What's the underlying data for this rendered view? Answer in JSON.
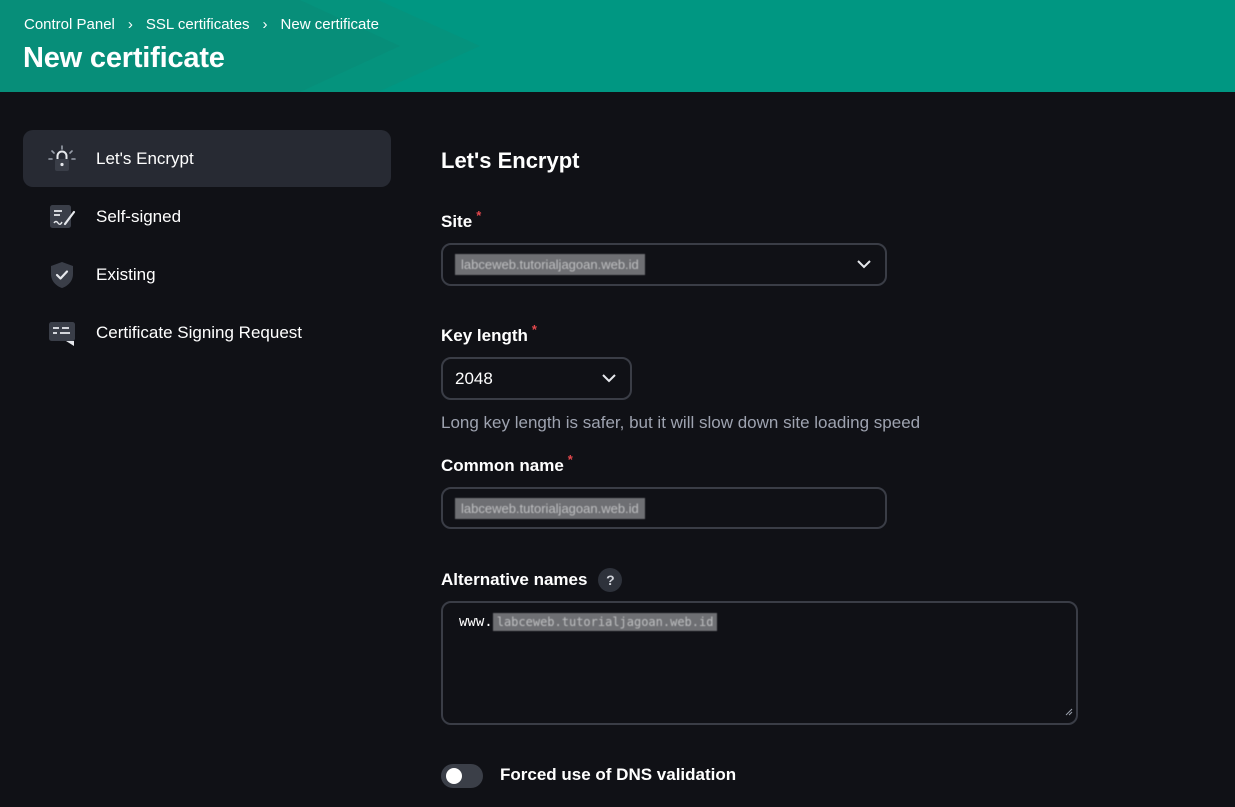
{
  "breadcrumb": {
    "items": [
      "Control Panel",
      "SSL certificates",
      "New certificate"
    ],
    "separator": "›"
  },
  "page": {
    "title": "New certificate"
  },
  "sidebar": {
    "items": [
      {
        "label": "Let's Encrypt",
        "icon": "lock-icon",
        "active": true
      },
      {
        "label": "Self-signed",
        "icon": "signed-document-icon",
        "active": false
      },
      {
        "label": "Existing",
        "icon": "shield-check-icon",
        "active": false
      },
      {
        "label": "Certificate Signing Request",
        "icon": "request-message-icon",
        "active": false
      }
    ]
  },
  "form": {
    "section_title": "Let's Encrypt",
    "site": {
      "label": "Site",
      "required_mark": "*",
      "value": "labceweb.tutorialjagoan.web.id"
    },
    "key_length": {
      "label": "Key length",
      "required_mark": "*",
      "value": "2048",
      "hint": "Long key length is safer, but it will slow down site loading speed"
    },
    "common_name": {
      "label": "Common name",
      "required_mark": "*",
      "value": "labceweb.tutorialjagoan.web.id"
    },
    "alternative_names": {
      "label": "Alternative names",
      "help": "?",
      "prefix": "www.",
      "value": "labceweb.tutorialjagoan.web.id"
    },
    "dns_validation": {
      "label": "Forced use of DNS validation",
      "enabled": false
    }
  },
  "colors": {
    "header": "#009782",
    "background": "#101116",
    "active_item": "#272a33",
    "required": "#e5484d"
  }
}
